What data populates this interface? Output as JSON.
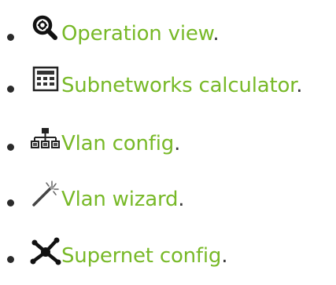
{
  "menu": {
    "items": [
      {
        "icon": "magnifier-gear-icon",
        "label": "Operation view",
        "suffix": "."
      },
      {
        "icon": "calculator-icon",
        "label": "Subnetworks calculator",
        "suffix": "."
      },
      {
        "icon": "network-tree-icon",
        "label": "Vlan config",
        "suffix": "."
      },
      {
        "icon": "magic-wand-icon",
        "label": "Vlan wizard",
        "suffix": "."
      },
      {
        "icon": "supernet-nodes-icon",
        "label": "Supernet config",
        "suffix": "."
      }
    ]
  },
  "colors": {
    "link": "#78b928",
    "text": "#3a3a3a",
    "bullet": "#2b2b2b"
  }
}
